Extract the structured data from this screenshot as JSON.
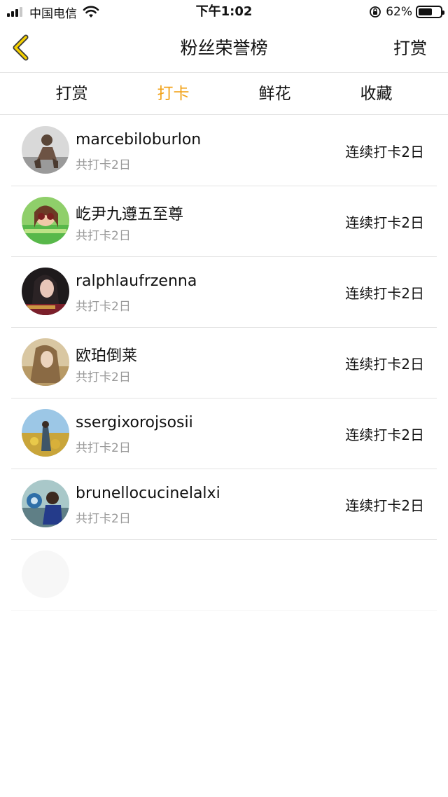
{
  "status_bar": {
    "carrier": "中国电信",
    "time": "下午1:02",
    "battery": "62%",
    "battery_level": 0.62,
    "signal_bars": 3,
    "signal_total": 4,
    "icons": [
      "signal-icon",
      "wifi-icon",
      "orientation-lock-icon",
      "battery-icon"
    ]
  },
  "navbar": {
    "back_icon": "chevron-left-icon",
    "title": "粉丝荣誉榜",
    "action_label": "打赏"
  },
  "tabs": [
    {
      "label": "打赏",
      "active": false
    },
    {
      "label": "打卡",
      "active": true
    },
    {
      "label": "鲜花",
      "active": false
    },
    {
      "label": "收藏",
      "active": false
    }
  ],
  "colors": {
    "accent": "#f2a31b",
    "text": "#111111",
    "subtext": "#9a9a9a",
    "divider": "#e3e3e3"
  },
  "fans": [
    {
      "name": "marcebiloburlon",
      "total": "共打卡2日",
      "streak": "连续打卡2日"
    },
    {
      "name": "屹尹九遵五至尊",
      "total": "共打卡2日",
      "streak": "连续打卡2日"
    },
    {
      "name": "ralphlaufrzenna",
      "total": "共打卡2日",
      "streak": "连续打卡2日"
    },
    {
      "name": "欧珀倒莱",
      "total": "共打卡2日",
      "streak": "连续打卡2日"
    },
    {
      "name": "ssergixorojsosii",
      "total": "共打卡2日",
      "streak": "连续打卡2日"
    },
    {
      "name": "brunellocucinelalxi",
      "total": "共打卡2日",
      "streak": "连续打卡2日"
    }
  ]
}
